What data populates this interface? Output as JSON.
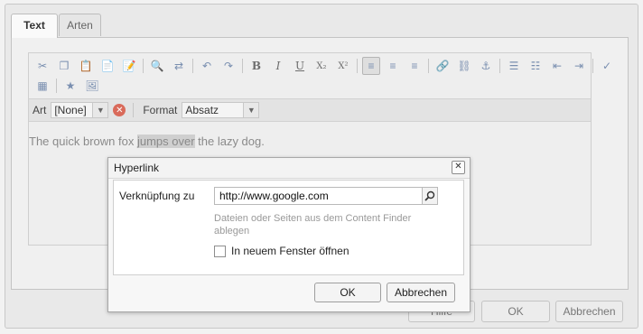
{
  "tabs": [
    {
      "label": "Text",
      "active": true
    },
    {
      "label": "Arten",
      "active": false
    }
  ],
  "toolbar": {
    "row1": [
      "cut-icon",
      "copy-icon",
      "paste-icon",
      "paste-text-icon",
      "paste-word-icon",
      "find-icon",
      "replace-icon",
      "undo-icon",
      "redo-icon",
      "bold-icon",
      "italic-icon",
      "underline-icon",
      "subscript-icon",
      "superscript-icon",
      "align-left-icon",
      "align-center-icon",
      "align-right-icon",
      "link-icon",
      "unlink-icon",
      "anchor-icon",
      "bullet-list-icon",
      "numbered-list-icon",
      "outdent-icon",
      "indent-icon",
      "spellcheck-icon"
    ],
    "row2": [
      "table-icon",
      "special-char-icon",
      "image-icon"
    ],
    "glyphs": {
      "bold": "B",
      "italic": "I",
      "underline": "U",
      "subscript": "X₂",
      "superscript": "X²"
    }
  },
  "format_bar": {
    "style_label": "Art",
    "style_value": "[None]",
    "format_label": "Format",
    "format_value": "Absatz"
  },
  "editor": {
    "text_before": "The quick brown fox ",
    "text_selected": "jumps over",
    "text_after": " the lazy dog."
  },
  "outer_buttons": {
    "help": "Hilfe",
    "ok": "OK",
    "cancel": "Abbrechen"
  },
  "dialog": {
    "title": "Hyperlink",
    "link_label": "Verknüpfung zu",
    "link_value": "http://www.google.com",
    "hint": "Dateien oder Seiten aus dem Content Finder ablegen",
    "new_window_label": "In neuem Fenster öffnen",
    "new_window_checked": false,
    "ok_label": "OK",
    "cancel_label": "Abbrechen"
  },
  "colors": {
    "selection_highlight": "#cfcfcf",
    "clear_icon": "#d96a5a"
  }
}
